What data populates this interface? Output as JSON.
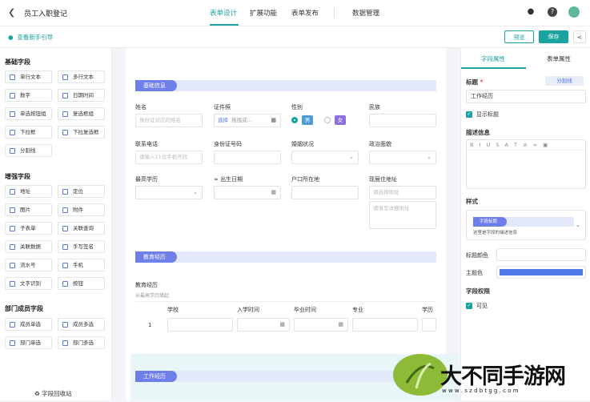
{
  "header": {
    "title": "员工入职登记",
    "tabs": [
      "表单设计",
      "扩展功能",
      "表单发布",
      "数据管理"
    ]
  },
  "subbar": {
    "guide": "查看新手引导",
    "preview": "预览",
    "save": "保存"
  },
  "left": {
    "basic_title": "基础字段",
    "basic": [
      "单行文本",
      "多行文本",
      "数字",
      "日期时间",
      "单选按钮组",
      "复选框组",
      "下拉框",
      "下拉复选框",
      "分割线"
    ],
    "enhanced_title": "增强字段",
    "enhanced": [
      "地址",
      "定位",
      "图片",
      "附件",
      "子表单",
      "关联查询",
      "关联数据",
      "手写签名",
      "流水号",
      "手机",
      "文字识别",
      "按钮"
    ],
    "dept_title": "部门成员字段",
    "dept": [
      "成员单选",
      "成员多选",
      "部门单选",
      "部门多选"
    ],
    "recycle": "字段回收站"
  },
  "canvas": {
    "section1": "基础信息",
    "name_label": "姓名",
    "name_ph": "身份证对应的姓名",
    "cert_label": "证件照",
    "cert_select": "选择",
    "cert_drag": "拖拽或...",
    "gender_label": "性别",
    "gender_male": "男",
    "gender_female": "女",
    "ethnic_label": "民族",
    "phone_label": "联系电话",
    "phone_ph": "请输入11位手机号码",
    "id_label": "身份证号码",
    "marital_label": "婚姻状况",
    "political_label": "政治面貌",
    "edu_label": "最高学历",
    "birth_label": "出生日期",
    "hukou_label": "户口所在地",
    "addr_label": "现居住地址",
    "addr_select_ph": "请选择地址",
    "addr_detail_ph": "请填写详细地址",
    "section2": "教育经历",
    "edu_exp_label": "教育经历",
    "edu_exp_hint": "从最高学历填起",
    "cols": [
      "学校",
      "入学时间",
      "毕业时间",
      "专业",
      "学历"
    ],
    "row_no": "1",
    "section3": "工作经历"
  },
  "right": {
    "tab_field": "字段属性",
    "tab_form": "表单属性",
    "title_label": "标题",
    "divider_btn": "分割线",
    "title_value": "工作经历",
    "show_title": "显示标题",
    "desc_label": "描述信息",
    "style_label": "样式",
    "style_tag": "字段标题",
    "style_desc": "这里是字段的描述信息",
    "title_color": "标题颜色",
    "theme_color": "主题色",
    "perm_label": "字段权限",
    "visible": "可见"
  },
  "watermark": {
    "brand": "大不同手游网",
    "url": "w w w . s z d b t g g . c o m"
  },
  "colors": {
    "accent": "#1aa3a0",
    "section": "#6f7fea",
    "theme": "#4f7be8"
  }
}
